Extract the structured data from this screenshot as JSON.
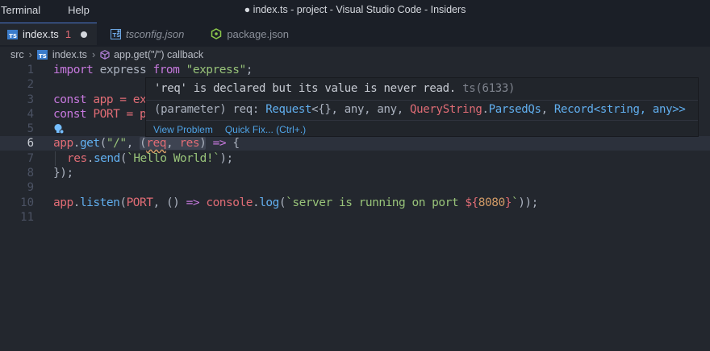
{
  "window": {
    "title": "● index.ts - project - Visual Studio Code - Insiders",
    "menu": [
      "Terminal",
      "Help"
    ]
  },
  "tabs": [
    {
      "label": "index.ts",
      "errors": "1",
      "dirty": true,
      "active": true,
      "icon": "typescript-file-icon"
    },
    {
      "label": "tsconfig.json",
      "italic": true,
      "icon": "tsconfig-file-icon"
    },
    {
      "label": "package.json",
      "icon": "nodejs-package-icon"
    }
  ],
  "breadcrumb": {
    "folder": "src",
    "file": "index.ts",
    "symbol": "app.get(\"/\") callback"
  },
  "code": {
    "line_numbers": [
      "1",
      "2",
      "3",
      "4",
      "5",
      "6",
      "7",
      "8",
      "9",
      "10",
      "11"
    ],
    "current_line": "6",
    "l1": {
      "kw1": "import",
      "id": " express ",
      "kw2": "from",
      "str": " \"express\"",
      "pl": ";"
    },
    "l3": {
      "kw": "const",
      "id": " app = ex"
    },
    "l4": {
      "kw": "const",
      "id": " PORT = p"
    },
    "l6": {
      "obj": "app",
      "dot": ".",
      "fn": "get",
      "open": "(",
      "str": "\"/\"",
      "comma": ", ",
      "lp": "(",
      "p1": "req",
      "comma2": ", ",
      "p2": "res",
      "rp": ")",
      "arrow": " => ",
      "brace": "{"
    },
    "l7": {
      "obj": "res",
      "dot": ".",
      "fn": "send",
      "open": "(",
      "str": "`Hello World!`",
      "close": ");"
    },
    "l8": {
      "text": "});"
    },
    "l10": {
      "obj": "app",
      "dot": ".",
      "fn": "listen",
      "open": "(",
      "var": "PORT",
      "mid": ", () ",
      "arrow": "=>",
      "sp": " ",
      "obj2": "console",
      "dot2": ".",
      "fn2": "log",
      "open2": "(",
      "str": "`server is running on port ",
      "i1": "${",
      "num": "8080",
      "i2": "}",
      "str2": "`",
      "close": "));"
    }
  },
  "hover": {
    "message": "'req' is declared but its value is never read.",
    "code_ref": "ts(6133)",
    "signature": {
      "a": "(parameter) req: ",
      "b": "Request",
      "c": "<{}, any, any, ",
      "d": "QueryString",
      "e": ".",
      "f": "ParsedQs",
      "g": ", ",
      "h": "Record",
      "i": "<string, any>>"
    },
    "actions": [
      "View Problem",
      "Quick Fix... (Ctrl+.)"
    ]
  },
  "colors": {
    "editor_bg": "#23272e",
    "keyword": "#c678dd",
    "string": "#98c379",
    "variable": "#e06c75",
    "function": "#61afef",
    "link": "#4fa3e6"
  }
}
